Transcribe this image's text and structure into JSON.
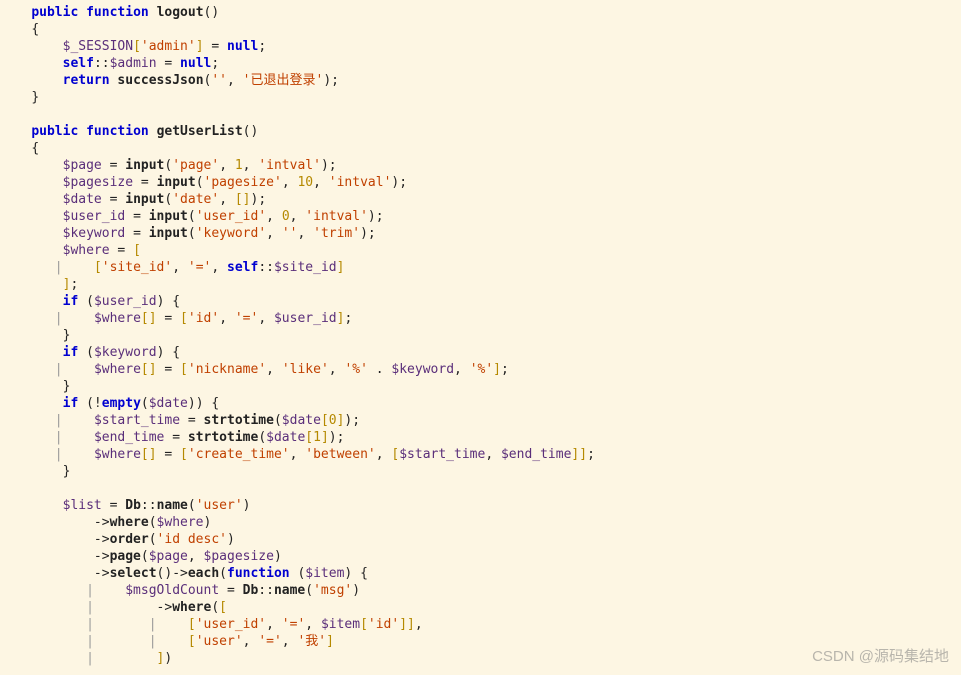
{
  "watermark": "CSDN @源码集结地",
  "tokens": {
    "kw_public": "public",
    "kw_function": "function",
    "kw_return": "return",
    "kw_self": "self",
    "kw_if": "if",
    "kw_empty": "empty",
    "kw_null1": "null",
    "kw_null2": "null",
    "fn_logout": "logout",
    "fn_getUserList": "getUserList",
    "fn_successJson": "successJson",
    "fn_input": "input",
    "fn_strtotime1": "strtotime",
    "fn_strtotime2": "strtotime",
    "fn_name": "name",
    "fn_where": "where",
    "fn_order": "order",
    "fn_page": "page",
    "fn_select": "select",
    "fn_each": "each",
    "v_SESSION": "$_SESSION",
    "v_admin": "$admin",
    "v_page": "$page",
    "v_pagesize": "$pagesize",
    "v_date": "$date",
    "v_user_id": "$user_id",
    "v_keyword": "$keyword",
    "v_where": "$where",
    "v_site_id": "$site_id",
    "v_start_time": "$start_time",
    "v_end_time": "$end_time",
    "v_list": "$list",
    "v_item": "$item",
    "v_msgOldCount": "$msgOldCount",
    "cls_Db": "Db",
    "s_admin": "'admin'",
    "s_empty1": "''",
    "s_logout_msg": "'已退出登录'",
    "s_page": "'page'",
    "s_intval1": "'intval'",
    "s_pagesize": "'pagesize'",
    "s_intval2": "'intval'",
    "s_date": "'date'",
    "s_user_id_k": "'user_id'",
    "s_intval3": "'intval'",
    "s_keyword_k": "'keyword'",
    "s_empty2": "''",
    "s_trim": "'trim'",
    "s_site_id": "'site_id'",
    "s_eq1": "'='",
    "s_id": "'id'",
    "s_eq2": "'='",
    "s_nickname": "'nickname'",
    "s_like": "'like'",
    "s_pct1": "'%'",
    "s_pct2": "'%'",
    "s_create_time": "'create_time'",
    "s_between": "'between'",
    "s_user_tbl": "'user'",
    "s_id_desc": "'id desc'",
    "s_msg_tbl": "'msg'",
    "s_user_id2": "'user_id'",
    "s_eq3": "'='",
    "s_id2": "'id'",
    "s_user": "'user'",
    "s_eq4": "'='",
    "s_wo": "'我'",
    "n_1": "1",
    "n_10": "10",
    "n_0a": "0",
    "n_0b": "0",
    "n_i1": "1"
  }
}
